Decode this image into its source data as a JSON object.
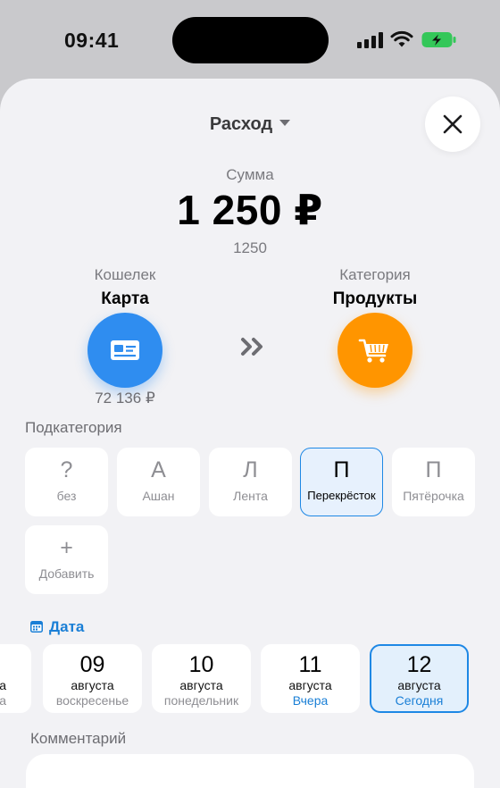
{
  "status_bar": {
    "time": "09:41"
  },
  "header": {
    "type_label": "Расход"
  },
  "amount": {
    "label": "Сумма",
    "value": "1 250 ₽",
    "raw": "1250"
  },
  "wallet": {
    "label": "Кошелек",
    "name": "Карта",
    "balance": "72 136 ₽",
    "color": "#2f8df0",
    "icon": "card-icon"
  },
  "category": {
    "label": "Категория",
    "name": "Продукты",
    "color": "#ff9500",
    "icon": "cart-icon"
  },
  "subcategory": {
    "label": "Подкатегория",
    "items": [
      {
        "letter": "?",
        "name": "без"
      },
      {
        "letter": "А",
        "name": "Ашан"
      },
      {
        "letter": "Л",
        "name": "Лента"
      },
      {
        "letter": "П",
        "name": "Перекрёсток",
        "selected": true
      },
      {
        "letter": "П",
        "name": "Пятёрочка"
      }
    ],
    "add": {
      "symbol": "+",
      "label": "Добавить"
    }
  },
  "date": {
    "label": "Дата",
    "cut_card": {
      "month": "а",
      "day": "а"
    },
    "cards": [
      {
        "num": "09",
        "month": "августа",
        "day": "воскресенье"
      },
      {
        "num": "10",
        "month": "августа",
        "day": "понедельник"
      },
      {
        "num": "11",
        "month": "августа",
        "day": "Вчера"
      },
      {
        "num": "12",
        "month": "августа",
        "day": "Сегодня",
        "selected": true
      }
    ]
  },
  "comment": {
    "label": "Комментарий",
    "value": ""
  },
  "colors": {
    "accent": "#1e88e5",
    "background": "#f2f2f5"
  }
}
